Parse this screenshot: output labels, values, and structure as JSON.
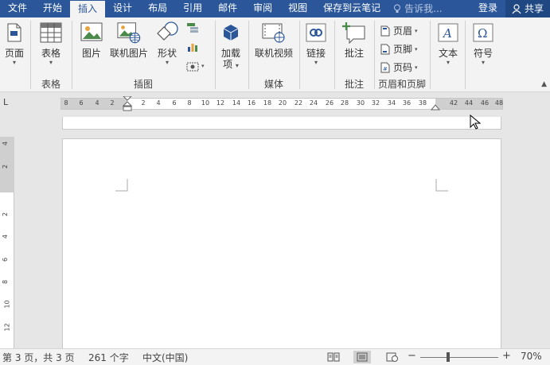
{
  "tabs": [
    "文件",
    "开始",
    "插入",
    "设计",
    "布局",
    "引用",
    "邮件",
    "审阅",
    "视图",
    "保存到云笔记"
  ],
  "active_tab": "插入",
  "tell_me_placeholder": "告诉我...",
  "login_label": "登录",
  "share_label": "共享",
  "ribbon": {
    "pages": {
      "label": "页面"
    },
    "table": {
      "button": "表格",
      "group": "表格"
    },
    "illustrations": {
      "picture": "图片",
      "online_picture": "联机图片",
      "shapes": "形状",
      "group": "插图"
    },
    "addins": {
      "button_line1": "加载",
      "button_line2": "项"
    },
    "media": {
      "online_video": "联机视频",
      "group": "媒体"
    },
    "links": {
      "button": "链接"
    },
    "comments": {
      "button": "批注",
      "group": "批注"
    },
    "header_footer": {
      "header": "页眉",
      "footer": "页脚",
      "page_number": "页码",
      "group": "页眉和页脚"
    },
    "text": {
      "button": "文本"
    },
    "symbols": {
      "button": "符号"
    }
  },
  "ruler_corner": "L",
  "hruler_numbers": [
    "8",
    "6",
    "4",
    "2",
    "2",
    "4",
    "6",
    "8",
    "10",
    "12",
    "14",
    "16",
    "18",
    "20",
    "22",
    "24",
    "26",
    "28",
    "30",
    "32",
    "34",
    "36",
    "38",
    "42",
    "44",
    "46",
    "48"
  ],
  "vruler_numbers": [
    "4",
    "2",
    "2",
    "4",
    "6",
    "8",
    "10",
    "12"
  ],
  "status": {
    "page": "第 3 页，共 3 页",
    "words": "261 个字",
    "language": "中文(中国)",
    "zoom_minus": "−",
    "zoom_plus": "+",
    "zoom": "70%"
  },
  "colors": {
    "accent": "#2b579a",
    "ribbon_bg": "#f3f3f3",
    "canvas_bg": "#e6e6e6"
  }
}
